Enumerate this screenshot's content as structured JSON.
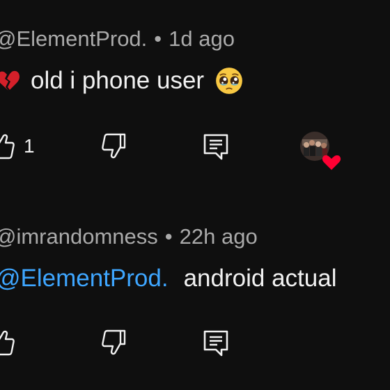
{
  "comments": [
    {
      "author": "@ElementProd.",
      "separator": "•",
      "time": "1d ago",
      "text": "old i phone user",
      "lead_emoji": "broken-heart",
      "trail_emoji": "pleading-face",
      "like_count": "1",
      "creator_heart": true
    },
    {
      "author": "@imrandomness",
      "separator": "•",
      "time": "22h ago",
      "mention": "@ElementProd.",
      "text": "android actual"
    }
  ],
  "colors": {
    "background": "#0f0f0f",
    "text": "#f1f1f1",
    "meta": "#aaaaaa",
    "mention": "#3ea6ff",
    "heart": "#ff0033"
  },
  "icons": [
    "like-icon",
    "dislike-icon",
    "reply-icon",
    "broken-heart-emoji",
    "pleading-face-emoji",
    "creator-heart-icon"
  ]
}
